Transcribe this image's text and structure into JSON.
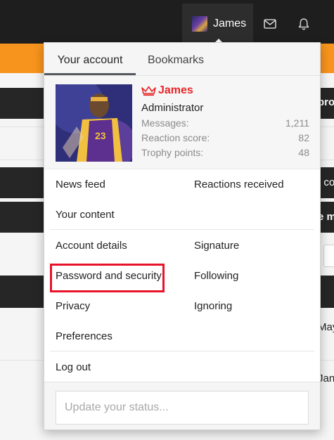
{
  "nav": {
    "username": "James",
    "icons": [
      "mail-icon",
      "bell-icon"
    ]
  },
  "background": {
    "snippets": [
      "pro",
      "t co",
      "e m",
      "May",
      "Jan"
    ]
  },
  "popup": {
    "tabs": [
      {
        "label": "Your account",
        "active": true
      },
      {
        "label": "Bookmarks",
        "active": false
      }
    ],
    "profile": {
      "name": "James",
      "role": "Administrator",
      "name_color": "#e8262a",
      "stats": [
        {
          "label": "Messages:",
          "value": "1,211"
        },
        {
          "label": "Reaction score:",
          "value": "82"
        },
        {
          "label": "Trophy points:",
          "value": "48"
        }
      ]
    },
    "menu": {
      "news_feed": "News feed",
      "reactions_received": "Reactions received",
      "your_content": "Your content",
      "account_details": "Account details",
      "signature": "Signature",
      "password_security": "Password and security",
      "following": "Following",
      "privacy": "Privacy",
      "ignoring": "Ignoring",
      "preferences": "Preferences",
      "log_out": "Log out"
    },
    "status": {
      "placeholder": "Update your status..."
    }
  },
  "colors": {
    "accent_orange": "#f7941d",
    "highlight_red": "#e8132a",
    "topbar": "#1e1e1e"
  }
}
